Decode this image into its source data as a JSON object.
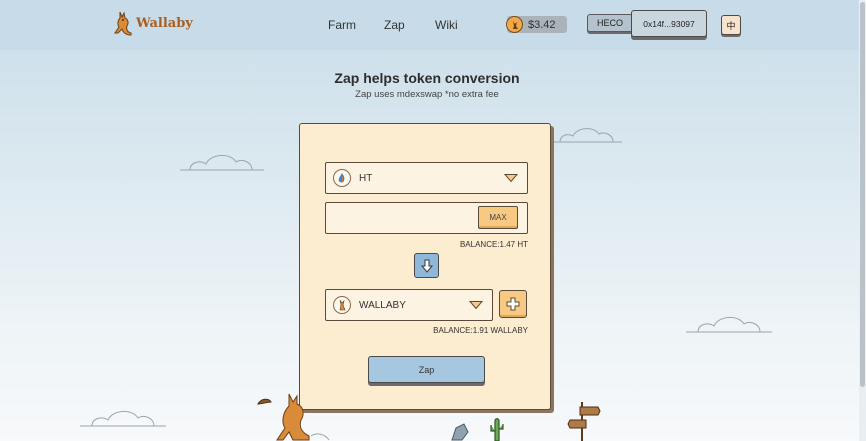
{
  "header": {
    "logo_text": "Wallaby",
    "nav": [
      {
        "label": "Farm"
      },
      {
        "label": "Zap"
      },
      {
        "label": "Wiki"
      }
    ],
    "price": "$3.42",
    "chain": "HECO",
    "address": "0x14f...93097",
    "language": "中"
  },
  "main": {
    "title": "Zap helps token conversion",
    "subtitle": "Zap uses mdexswap *no extra fee",
    "from_token": {
      "name": "HT",
      "icon": "ht-token-icon"
    },
    "amount": {
      "value": "",
      "placeholder": ""
    },
    "max_label": "MAX",
    "from_balance": "BALANCE:1.47 HT",
    "to_token": {
      "name": "WALLABY",
      "icon": "wallaby-token-icon"
    },
    "to_balance": "BALANCE:1.91 WALLABY",
    "zap_label": "Zap"
  },
  "colors": {
    "header_bg": "#c7dce8",
    "card_bg": "#fcecd0",
    "accent_orange": "#f7c983",
    "accent_blue": "#a5c7e0",
    "logo_brown": "#a85f21"
  }
}
